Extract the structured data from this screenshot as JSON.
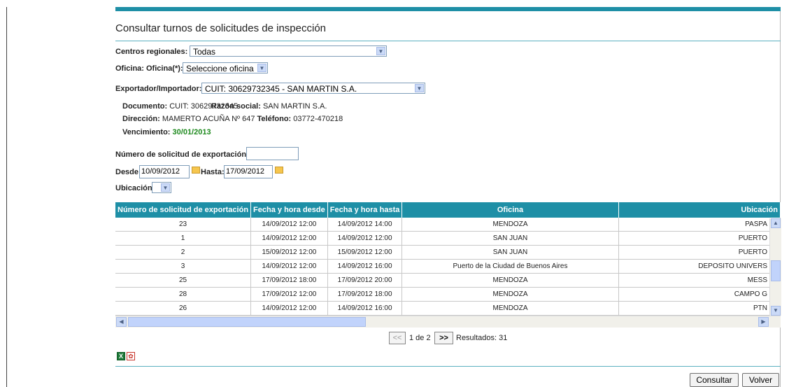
{
  "page": {
    "title": "Consultar turnos de solicitudes de inspección"
  },
  "filters": {
    "centros_label": "Centros regionales:",
    "centros_value": "Todas",
    "oficina_label": "Oficina: Oficina(*):",
    "oficina_value": "Seleccione oficina",
    "exportador_label": "Exportador/Importador:",
    "exportador_value": "CUIT: 30629732345 - SAN MARTIN S.A."
  },
  "info": {
    "documento_label": "Documento:",
    "documento_value": "CUIT: 30629732345",
    "razon_label": "Razón social:",
    "razon_value": "SAN MARTIN S.A.",
    "direccion_label": "Dirección:",
    "direccion_value": "MAMERTO ACUÑA Nº 647",
    "telefono_label": "Teléfono:",
    "telefono_value": "03772-470218",
    "vencimiento_label": "Vencimiento:",
    "vencimiento_value": "30/01/2013",
    "vencimiento_color": "#1E8A1E"
  },
  "search": {
    "numero_label": "Número de solicitud de exportación:",
    "numero_value": "",
    "desde_label": "Desde:",
    "desde_value": "10/09/2012",
    "hasta_label": "Hasta:",
    "hasta_value": "17/09/2012",
    "ubicacion_label": "Ubicación:",
    "ubicacion_value": ""
  },
  "table": {
    "headers": [
      "Número de solicitud de exportación",
      "Fecha y hora desde",
      "Fecha y hora hasta",
      "Oficina",
      "Ubicación"
    ],
    "rows": [
      [
        "23",
        "14/09/2012 12:00",
        "14/09/2012 14:00",
        "MENDOZA",
        "PASPA"
      ],
      [
        "1",
        "14/09/2012 12:00",
        "14/09/2012 12:00",
        "SAN JUAN",
        "PUERTO"
      ],
      [
        "2",
        "15/09/2012 12:00",
        "15/09/2012 12:00",
        "SAN JUAN",
        "PUERTO"
      ],
      [
        "3",
        "14/09/2012 12:00",
        "14/09/2012 16:00",
        "Puerto de la Ciudad de Buenos Aires",
        "DEPOSITO UNIVERS"
      ],
      [
        "25",
        "17/09/2012 18:00",
        "17/09/2012 20:00",
        "MENDOZA",
        "MESS"
      ],
      [
        "28",
        "17/09/2012 12:00",
        "17/09/2012 18:00",
        "MENDOZA",
        "CAMPO G"
      ],
      [
        "26",
        "14/09/2012 12:00",
        "14/09/2012 16:00",
        "MENDOZA",
        "PTN"
      ]
    ]
  },
  "pager": {
    "prev": "<<",
    "page_text": "1 de 2",
    "next": ">>",
    "results": "Resultados: 31"
  },
  "actions": {
    "consultar": "Consultar",
    "volver": "Volver"
  },
  "colors": {
    "accent": "#1E8FA6"
  }
}
